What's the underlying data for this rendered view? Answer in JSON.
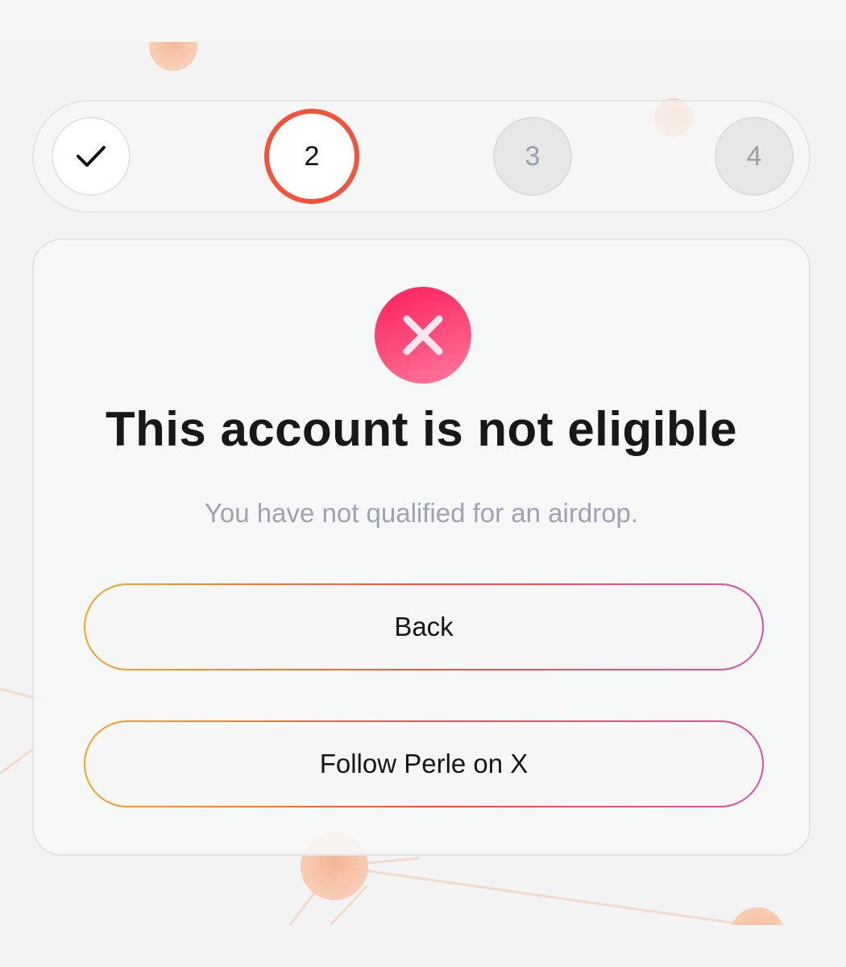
{
  "stepper": {
    "steps": [
      {
        "label": "",
        "state": "completed",
        "icon": "checkmark-icon"
      },
      {
        "label": "2",
        "state": "current"
      },
      {
        "label": "3",
        "state": "upcoming"
      },
      {
        "label": "4",
        "state": "upcoming"
      }
    ]
  },
  "card": {
    "status_icon": "close-x-icon",
    "title": "This account is not eligible",
    "subtitle": "You have not qualified for an airdrop.",
    "back_label": "Back",
    "follow_label": "Follow Perle on X"
  },
  "colors": {
    "accent_orange": "#f5523a",
    "error_pink": "#ff2d67",
    "gradient_start": "#f5a623",
    "gradient_end": "#e34fa4",
    "muted_text": "#9ea3ae"
  }
}
